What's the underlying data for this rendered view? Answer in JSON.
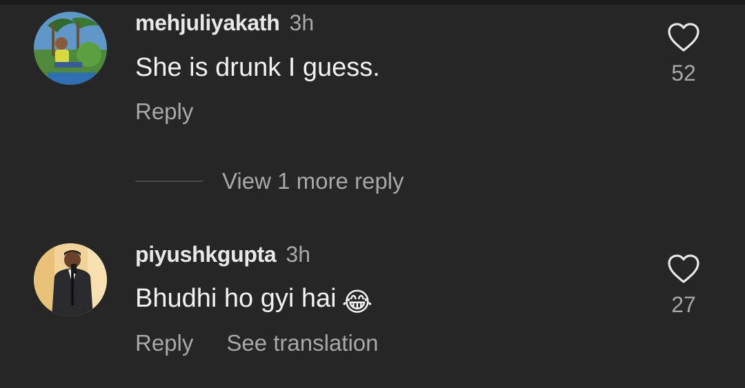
{
  "comments": [
    {
      "username": "mehjuliyakath",
      "time": "3h",
      "text": "She is drunk I guess.",
      "likes": "52",
      "reply_label": "Reply",
      "avatar_icon": "avatar-photo-child-palm-trees"
    },
    {
      "username": "piyushkgupta",
      "time": "3h",
      "text": "Bhudhi ho gyi hai",
      "emoji": "😂",
      "likes": "27",
      "reply_label": "Reply",
      "translate_label": "See translation",
      "avatar_icon": "avatar-photo-man-in-suit"
    }
  ],
  "view_replies": {
    "label": "View 1 more reply"
  },
  "colors": {
    "background": "#262626",
    "primary_text": "#f2f2f2",
    "secondary_text": "#a8a8a8"
  },
  "icons": {
    "like": "heart-outline-icon"
  }
}
